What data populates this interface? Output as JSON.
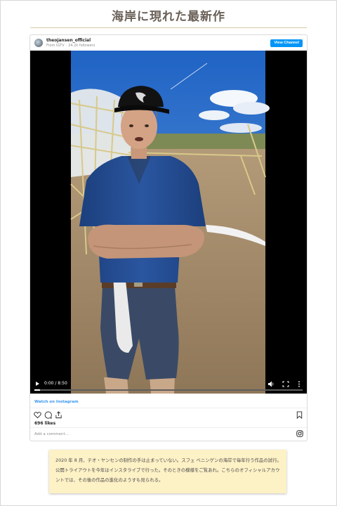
{
  "page": {
    "title": "海岸に現れた最新作"
  },
  "embed": {
    "username": "theojansen_official",
    "source": "From IGTV",
    "followers": "24.2k followers",
    "view_channel_label": "View Channel",
    "video": {
      "time": "0:00 / 8:50",
      "progress": 0.02
    },
    "watch_link": "Watch on Instagram",
    "likes": "696 likes",
    "comment_placeholder": "Add a comment...",
    "icons": {
      "like": "heart-icon",
      "comment": "comment-icon",
      "share": "share-icon",
      "save": "bookmark-icon",
      "brand": "instagram-icon",
      "volume": "volume-icon",
      "fullscreen": "fullscreen-icon",
      "more": "more-vertical-icon",
      "play": "play-icon"
    }
  },
  "caption": {
    "text": "2020 年 8 月、テオ・ヤンセンの制作の手は止まっていない。スフェ ベニンゲンの海岸で毎年行う作品の試行。公開トライアウトを今年はインスタライブで行った。そのときの模様をご覧あれ。こちらのオフィシャルアカウントでは、その後の作品の進化のようすも見られる。"
  },
  "colors": {
    "title": "#6a6158",
    "title_rule": "#d9c9a6",
    "accent_blue": "#0095f6",
    "link_blue": "#3897f0",
    "caption_bg": "#fdf1c6"
  }
}
